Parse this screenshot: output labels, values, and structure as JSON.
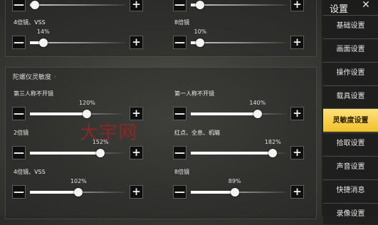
{
  "top_panel": {
    "sliders": [
      {
        "label": "",
        "percent": "",
        "value": 0.05
      },
      {
        "label": "",
        "percent": "",
        "value": 0.1
      },
      {
        "label": "4倍镜、VSS",
        "percent": "14%",
        "value": 0.14
      },
      {
        "label": "8倍镜",
        "percent": "10%",
        "value": 0.1
      }
    ]
  },
  "gyro": {
    "title": "陀螺仪灵敏度",
    "title_suffix": "◦",
    "sliders": [
      {
        "label": "第三人称不开镜",
        "percent": "120%",
        "value": 0.6
      },
      {
        "label": "第一人称不开镜",
        "percent": "140%",
        "value": 0.7
      },
      {
        "label": "2倍镜",
        "percent": "152%",
        "value": 0.74
      },
      {
        "label": "红点、全息、机瞄",
        "percent": "182%",
        "value": 0.86
      },
      {
        "label": "4倍镜、VSS",
        "percent": "102%",
        "value": 0.51
      },
      {
        "label": "8倍镜",
        "percent": "89%",
        "value": 0.46
      }
    ]
  },
  "controls": {
    "minus": "—",
    "plus": "+"
  },
  "sidebar": {
    "title": "设置",
    "close_glyph": "✕",
    "items": [
      {
        "label": "基础设置",
        "active": false
      },
      {
        "label": "画面设置",
        "active": false
      },
      {
        "label": "操作设置",
        "active": false
      },
      {
        "label": "载具设置",
        "active": false
      },
      {
        "label": "灵敏度设置",
        "active": true
      },
      {
        "label": "拾取设置",
        "active": false
      },
      {
        "label": "声音设置",
        "active": false
      },
      {
        "label": "快捷消息",
        "active": false
      },
      {
        "label": "录像设置",
        "active": false
      }
    ]
  },
  "watermark": "大宇网",
  "colors": {
    "active_tab": "#f0c02c",
    "watermark": "#c81e1e"
  }
}
